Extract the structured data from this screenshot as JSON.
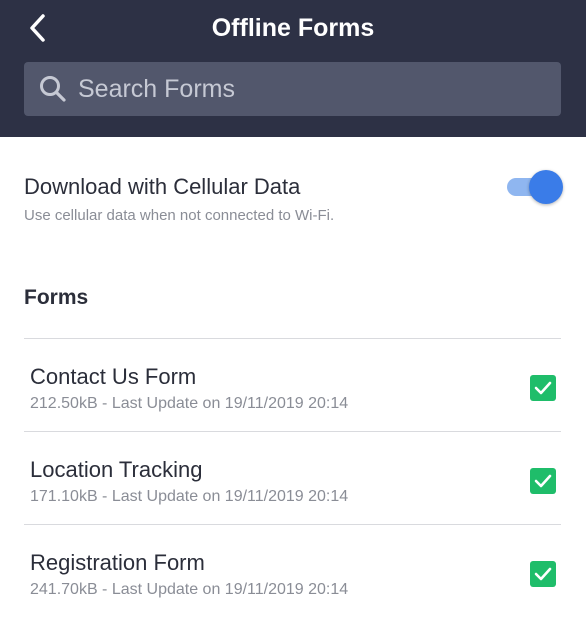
{
  "header": {
    "title": "Offline Forms",
    "back_icon": "chevron-left-icon",
    "bg_color": "#2d3145"
  },
  "search": {
    "placeholder": "Search Forms",
    "value": "",
    "icon": "search-icon"
  },
  "cellular": {
    "title": "Download with Cellular Data",
    "subtitle": "Use cellular data when not connected to Wi-Fi.",
    "toggle_on": true,
    "accent_color": "#3a7ce8"
  },
  "forms_section": {
    "title": "Forms",
    "items": [
      {
        "name": "Contact Us Form",
        "meta": "212.50kB - Last Update on 19/11/2019 20:14",
        "checked": true
      },
      {
        "name": "Location Tracking",
        "meta": "171.10kB - Last Update on 19/11/2019 20:14",
        "checked": true
      },
      {
        "name": "Registration Form",
        "meta": "241.70kB - Last Update on 19/11/2019 20:14",
        "checked": true
      }
    ],
    "check_color": "#1fbd6a"
  }
}
